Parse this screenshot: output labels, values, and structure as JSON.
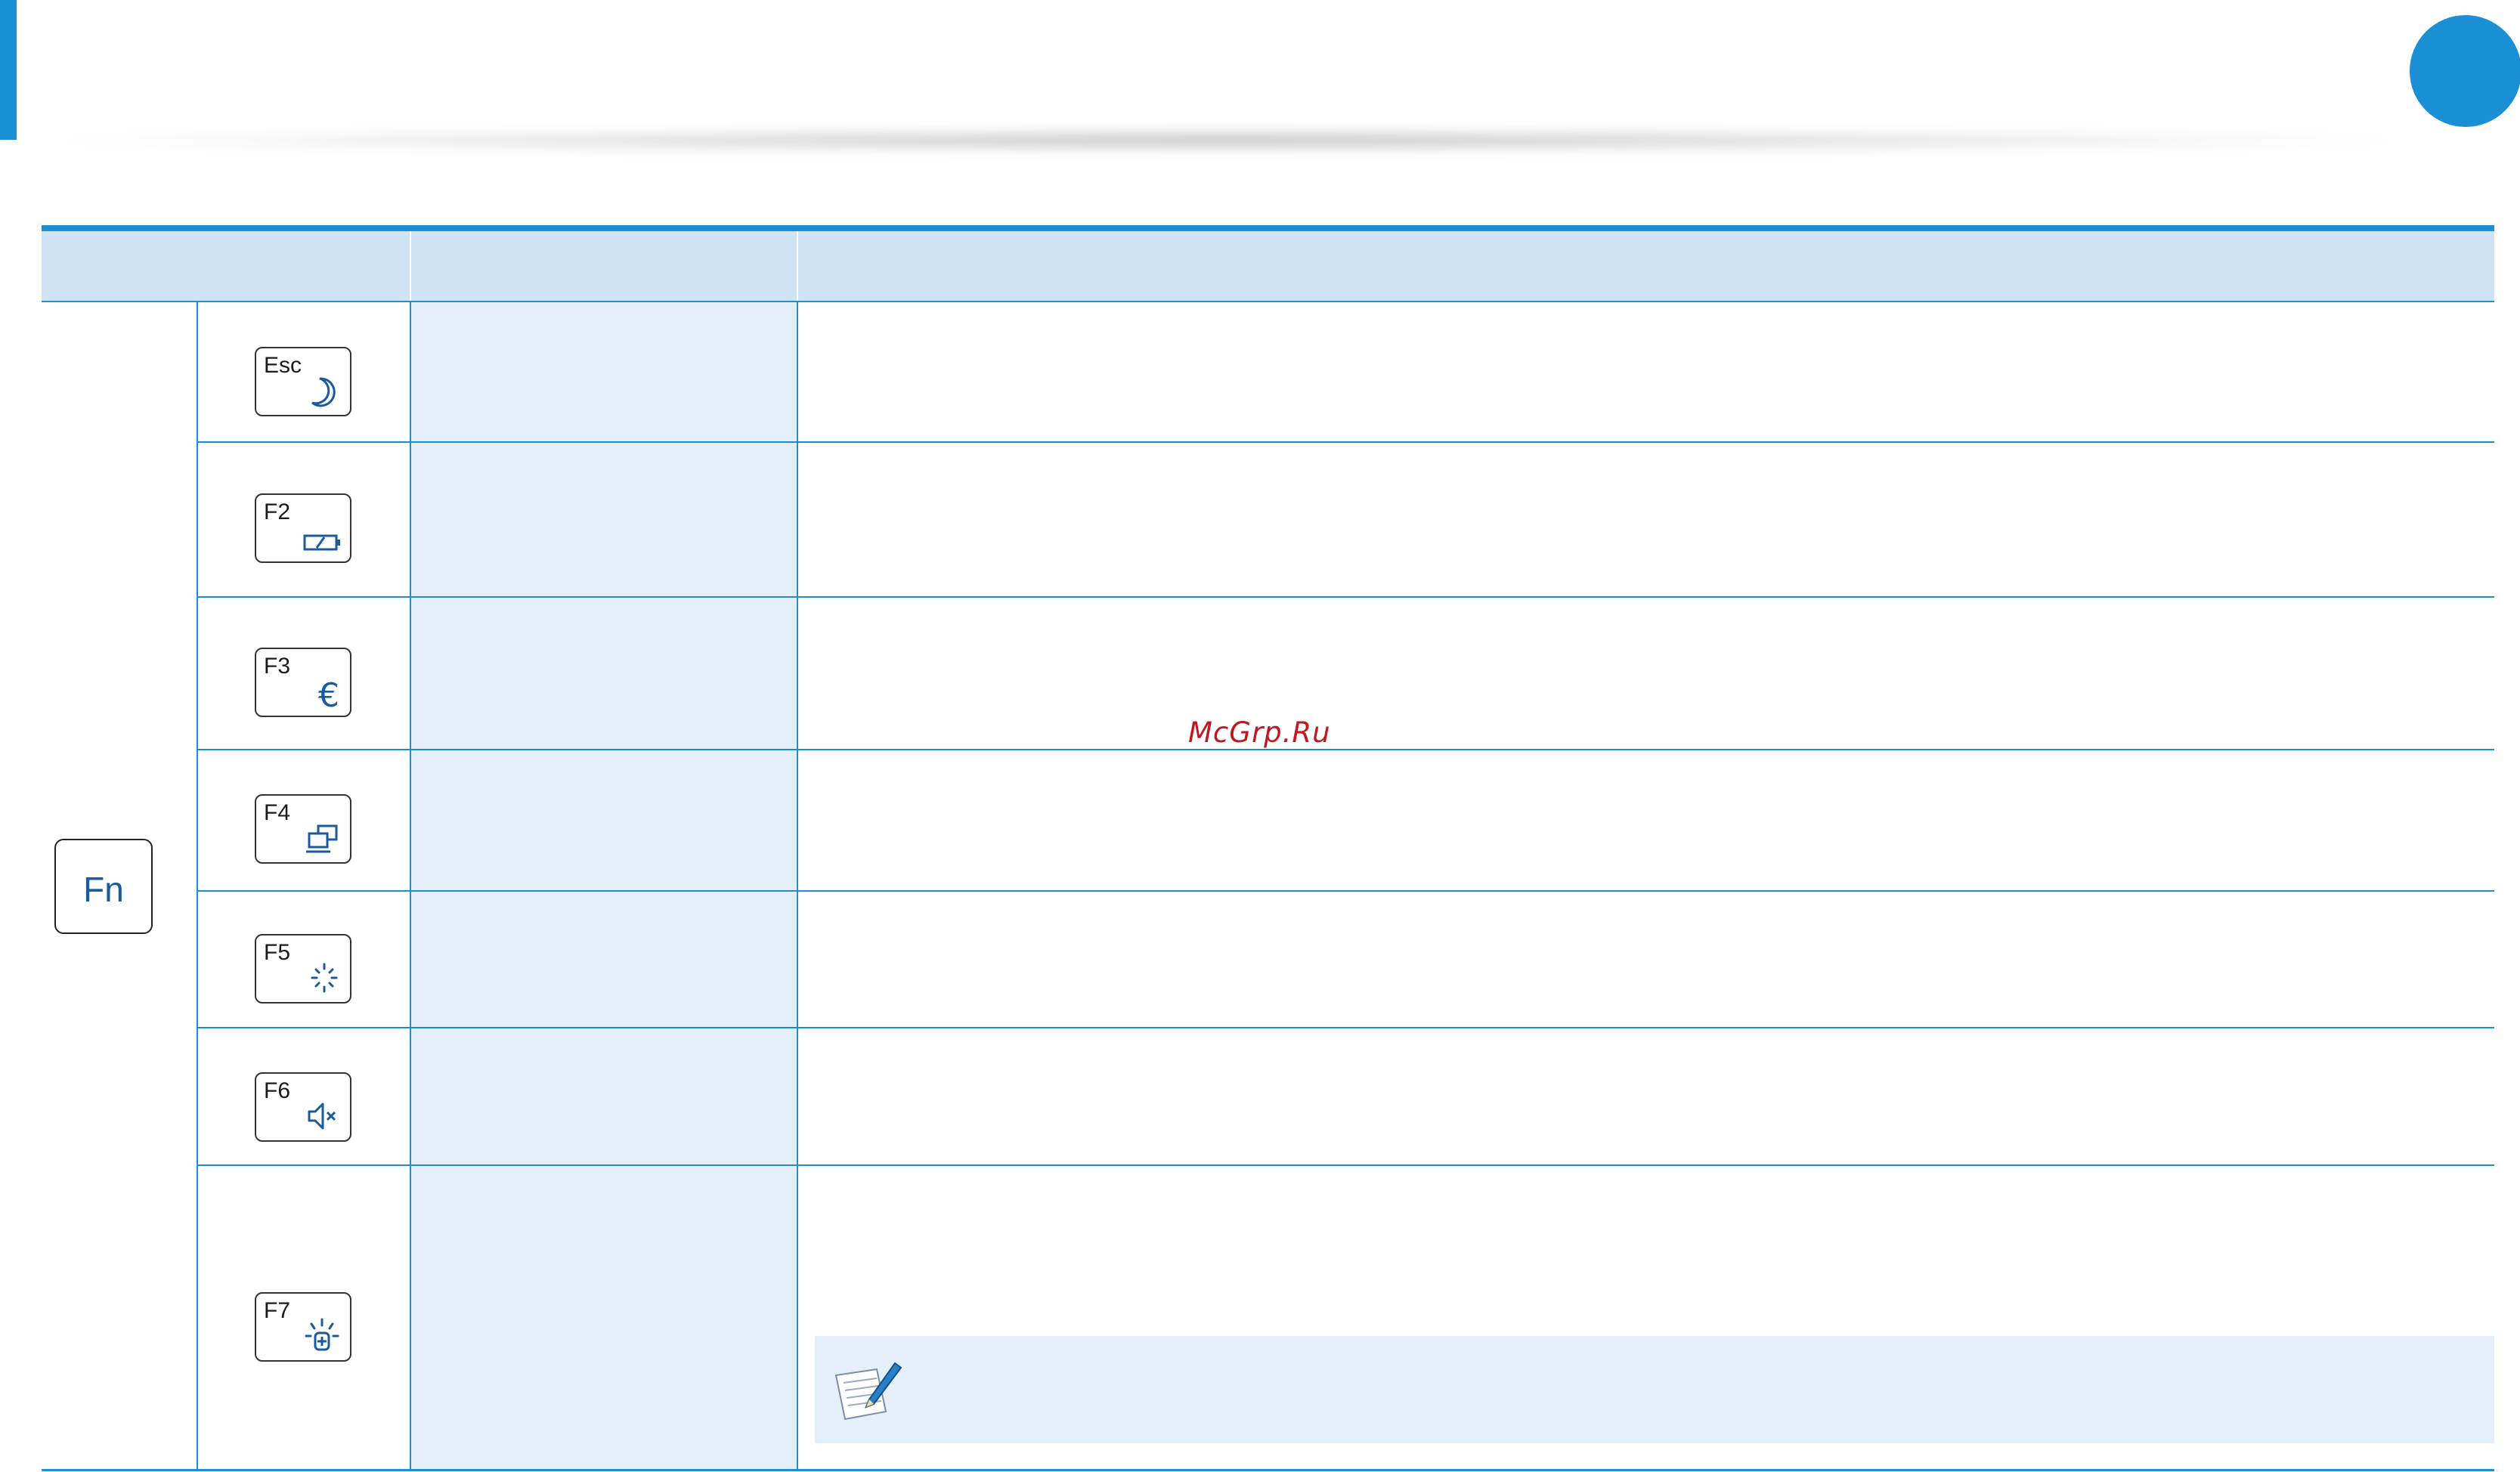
{
  "header": {
    "accent_color": "#1b8fd6"
  },
  "watermark": "McGrp.Ru",
  "table": {
    "columns": [
      "",
      "",
      ""
    ],
    "modifier_key": "Fn",
    "rows": [
      {
        "key_label": "Esc",
        "icon": "moon-icon",
        "name": "",
        "description": ""
      },
      {
        "key_label": "F2",
        "icon": "battery-icon",
        "name": "",
        "description": ""
      },
      {
        "key_label": "F3",
        "icon": "euro-icon",
        "name": "",
        "description": ""
      },
      {
        "key_label": "F4",
        "icon": "display-switch-icon",
        "name": "",
        "description": ""
      },
      {
        "key_label": "F5",
        "icon": "touchpad-icon",
        "name": "",
        "description": ""
      },
      {
        "key_label": "F6",
        "icon": "mute-icon",
        "name": "",
        "description": ""
      },
      {
        "key_label": "F7",
        "icon": "backlight-icon",
        "name": "",
        "description": "",
        "note": ""
      }
    ]
  }
}
